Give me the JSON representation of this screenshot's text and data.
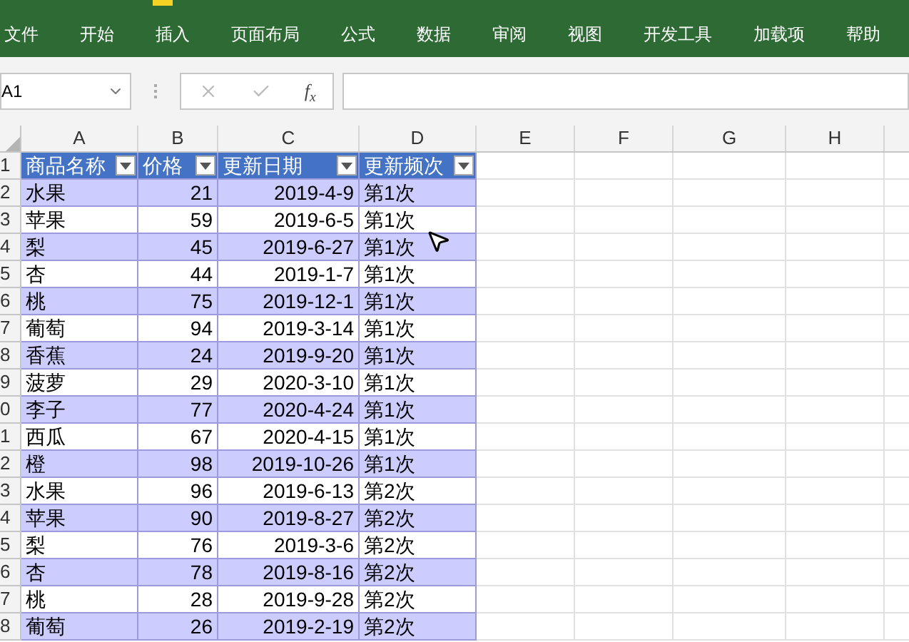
{
  "ribbon": {
    "tabs": [
      {
        "label": "文件"
      },
      {
        "label": "开始"
      },
      {
        "label": "插入"
      },
      {
        "label": "页面布局"
      },
      {
        "label": "公式"
      },
      {
        "label": "数据"
      },
      {
        "label": "审阅"
      },
      {
        "label": "视图"
      },
      {
        "label": "开发工具"
      },
      {
        "label": "加载项"
      },
      {
        "label": "帮助"
      }
    ]
  },
  "formula_bar": {
    "name_box": "A1",
    "function_label": "f$_{x}$"
  },
  "columns": [
    "A",
    "B",
    "C",
    "D",
    "E",
    "F",
    "G",
    "H"
  ],
  "table": {
    "header_row_number": "1",
    "headers": [
      "商品名称",
      "价格",
      "更新日期",
      "更新频次"
    ],
    "rows": [
      {
        "row_number": "2",
        "banded": true,
        "cells": [
          "水果",
          "21",
          "2019-4-9",
          "第1次"
        ]
      },
      {
        "row_number": "3",
        "banded": false,
        "cells": [
          "苹果",
          "59",
          "2019-6-5",
          "第1次"
        ]
      },
      {
        "row_number": "4",
        "banded": true,
        "cells": [
          "梨",
          "45",
          "2019-6-27",
          "第1次"
        ]
      },
      {
        "row_number": "5",
        "banded": false,
        "cells": [
          "杏",
          "44",
          "2019-1-7",
          "第1次"
        ]
      },
      {
        "row_number": "6",
        "banded": true,
        "cells": [
          "桃",
          "75",
          "2019-12-1",
          "第1次"
        ]
      },
      {
        "row_number": "7",
        "banded": false,
        "cells": [
          "葡萄",
          "94",
          "2019-3-14",
          "第1次"
        ]
      },
      {
        "row_number": "8",
        "banded": true,
        "cells": [
          "香蕉",
          "24",
          "2019-9-20",
          "第1次"
        ]
      },
      {
        "row_number": "9",
        "banded": false,
        "cells": [
          "菠萝",
          "29",
          "2020-3-10",
          "第1次"
        ]
      },
      {
        "row_number": "0",
        "banded": true,
        "cells": [
          "李子",
          "77",
          "2020-4-24",
          "第1次"
        ]
      },
      {
        "row_number": "1",
        "banded": false,
        "cells": [
          "西瓜",
          "67",
          "2020-4-15",
          "第1次"
        ]
      },
      {
        "row_number": "2",
        "banded": true,
        "cells": [
          "橙",
          "98",
          "2019-10-26",
          "第1次"
        ]
      },
      {
        "row_number": "3",
        "banded": false,
        "cells": [
          "水果",
          "96",
          "2019-6-13",
          "第2次"
        ]
      },
      {
        "row_number": "4",
        "banded": true,
        "cells": [
          "苹果",
          "90",
          "2019-8-27",
          "第2次"
        ]
      },
      {
        "row_number": "5",
        "banded": false,
        "cells": [
          "梨",
          "76",
          "2019-3-6",
          "第2次"
        ]
      },
      {
        "row_number": "6",
        "banded": true,
        "cells": [
          "杏",
          "78",
          "2019-8-16",
          "第2次"
        ]
      },
      {
        "row_number": "7",
        "banded": false,
        "cells": [
          "桃",
          "28",
          "2019-9-28",
          "第2次"
        ]
      },
      {
        "row_number": "8",
        "banded": true,
        "cells": [
          "葡萄",
          "26",
          "2019-2-19",
          "第2次"
        ]
      }
    ]
  }
}
